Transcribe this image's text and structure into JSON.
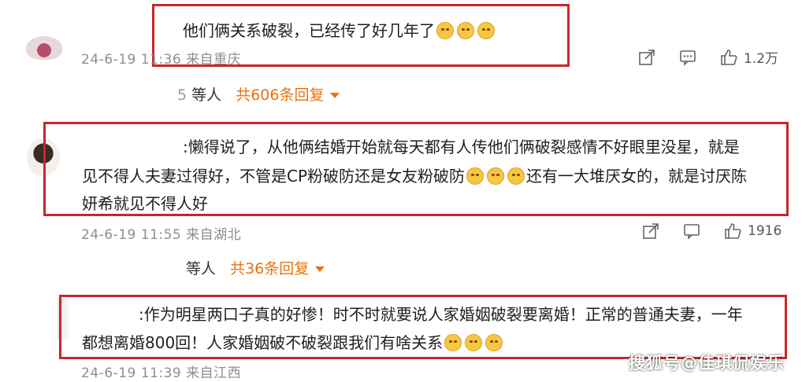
{
  "comments": [
    {
      "text": "他们俩关系破裂，已经传了好几年了",
      "emojis": 3,
      "time": "24-6-19 11:36",
      "location": "来自重庆",
      "likes": "1.2万",
      "reply_prefix": "5",
      "reply_who": "等人",
      "reply_count": "共606条回复"
    },
    {
      "lines": [
        ":懒得说了，从他俩结婚开始就每天都有人传他们俩破裂感情不好眼里没星，就是",
        "见不得人夫妻过得好，不管是CP粉破防还是女友粉破防",
        "还有一大堆厌女的，就是讨厌陈",
        "妍希就见不得人好"
      ],
      "time": "24-6-19 11:55",
      "location": "来自湖北",
      "likes": "1916",
      "reply_prefix": "",
      "reply_who": "等人",
      "reply_count": "共36条回复"
    },
    {
      "lines": [
        ":作为明星两口子真的好惨！时不时就要说人家婚姻破裂要离婚！正常的普通夫妻，一年",
        "都想离婚800回！人家婚姻破不破裂跟我们有啥关系"
      ],
      "time": "24-6-19 11:39",
      "location": "来自江西"
    }
  ],
  "watermark": "搜狐号@佳琪侃娱乐",
  "colors": {
    "highlight": "#c8262c",
    "reply_accent": "#e8720c"
  },
  "icons": [
    "share-icon",
    "comment-icon",
    "thumbs-up-icon"
  ]
}
